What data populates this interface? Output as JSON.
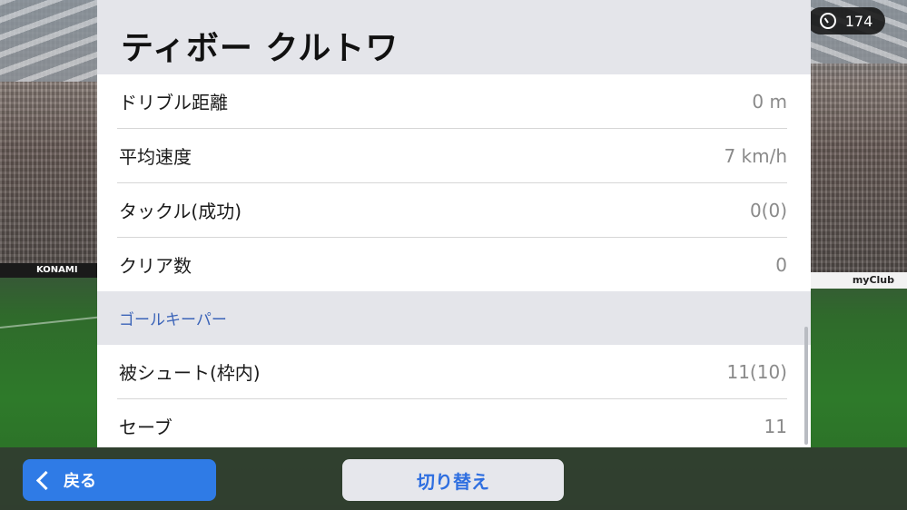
{
  "counter": {
    "value": "174"
  },
  "player": {
    "name": "ティボー クルトワ"
  },
  "stats": [
    {
      "label": "ドリブル距離",
      "value": "0 m"
    },
    {
      "label": "平均速度",
      "value": "7 km/h"
    },
    {
      "label": "タックル(成功)",
      "value": "0(0)"
    },
    {
      "label": "クリア数",
      "value": "0"
    }
  ],
  "goalkeeper": {
    "section_title": "ゴールキーパー",
    "stats": [
      {
        "label": "被シュート(枠内)",
        "value": "11(10)"
      },
      {
        "label": "セーブ",
        "value": "11"
      }
    ]
  },
  "footer": {
    "back_label": "戻る",
    "switch_label": "切り替え"
  },
  "ads": {
    "left": "KONAMI",
    "right": "myClub"
  }
}
